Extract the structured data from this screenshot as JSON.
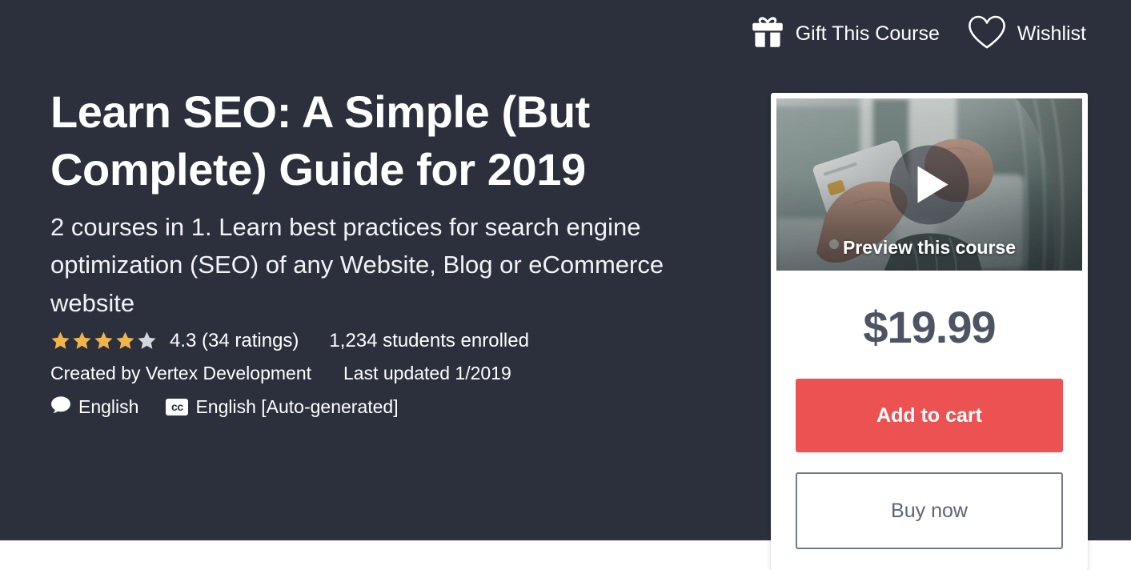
{
  "theme": {
    "hero_bg": "#2b303c",
    "page_bg": "#ffffff",
    "accent_cart": "#ec5252",
    "price_color": "#4d5564",
    "star_filled": "#f0b44b",
    "star_empty": "#d1d7dc"
  },
  "top_actions": [
    {
      "icon": "gift-icon",
      "label": "Gift This Course"
    },
    {
      "icon": "heart-icon",
      "label": "Wishlist"
    }
  ],
  "course": {
    "title": "Learn SEO: A Simple (But Complete) Guide for 2019",
    "subtitle": "2 courses in 1. Learn best practices for search engine optimization (SEO) of any Website, Blog or eCommerce website",
    "rating": {
      "stars_filled": 4,
      "stars_total": 5,
      "value_text": "4.3 (34 ratings)"
    },
    "enrolled_text": "1,234 students enrolled",
    "created_by": "Created by Vertex Development",
    "last_updated": "Last updated 1/2019",
    "language": "English",
    "captions_badge": "cc",
    "captions": "English [Auto-generated]"
  },
  "purchase_card": {
    "preview_caption": "Preview this course",
    "play_icon": "play-icon",
    "price": "$19.99",
    "add_to_cart_label": "Add to cart",
    "buy_now_label": "Buy now"
  }
}
